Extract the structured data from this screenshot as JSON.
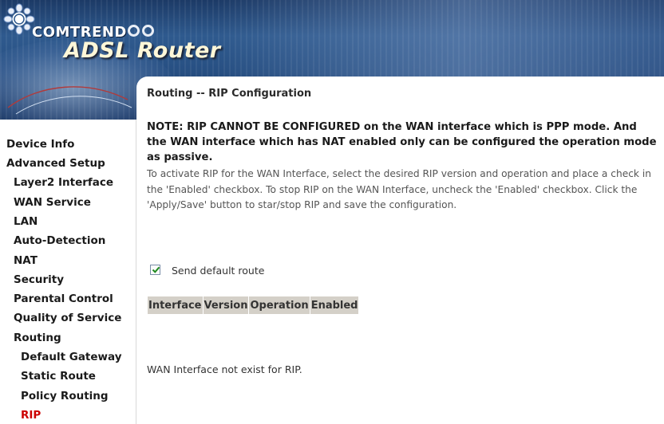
{
  "header": {
    "brand": "COMTREND",
    "product": "ADSL Router"
  },
  "sidebar": {
    "items": [
      {
        "label": "Device Info",
        "level": 1
      },
      {
        "label": "Advanced Setup",
        "level": 1
      },
      {
        "label": "Layer2 Interface",
        "level": 2
      },
      {
        "label": "WAN Service",
        "level": 2
      },
      {
        "label": "LAN",
        "level": 2
      },
      {
        "label": "Auto-Detection",
        "level": 2
      },
      {
        "label": "NAT",
        "level": 2
      },
      {
        "label": "Security",
        "level": 2
      },
      {
        "label": "Parental Control",
        "level": 2
      },
      {
        "label": "Quality of Service",
        "level": 2
      },
      {
        "label": "Routing",
        "level": 2
      },
      {
        "label": "Default Gateway",
        "level": 3
      },
      {
        "label": "Static Route",
        "level": 3
      },
      {
        "label": "Policy Routing",
        "level": 3
      },
      {
        "label": "RIP",
        "level": 3,
        "active": true
      }
    ],
    "active_color": "#cc0000"
  },
  "main": {
    "title": "Routing -- RIP Configuration",
    "note": "NOTE: RIP CANNOT BE CONFIGURED on the WAN interface which is PPP mode. And the WAN interface which has NAT enabled only can be configured the operation mode as passive.",
    "description": "To activate RIP for the WAN Interface, select the desired RIP version and operation and place a check in the 'Enabled' checkbox. To stop RIP on the WAN Interface, uncheck the 'Enabled' checkbox. Click the 'Apply/Save' button to star/stop RIP and save the configuration.",
    "send_default_route": {
      "label": "Send default route",
      "checked": true
    },
    "table": {
      "columns": [
        "Interface",
        "Version",
        "Operation",
        "Enabled"
      ]
    },
    "message": "WAN Interface not exist for RIP."
  }
}
